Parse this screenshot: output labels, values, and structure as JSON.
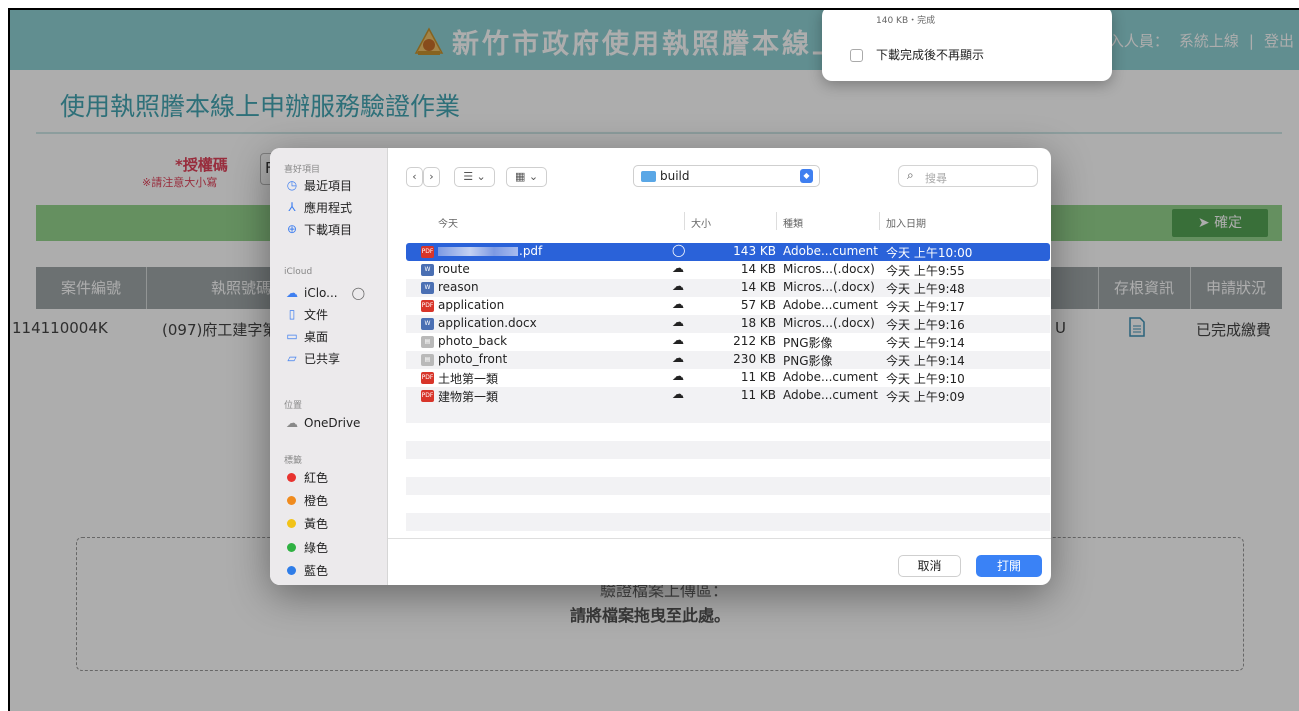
{
  "header": {
    "title": "新竹市政府使用執照謄本線上申",
    "user_label": "入人員：",
    "user_name": "系統上線",
    "separator": "|",
    "logout": "登出"
  },
  "page": {
    "title": "使用執照謄本線上申辦服務驗證作業",
    "auth_label": "*授權碼",
    "auth_note": "※請注意大小寫",
    "auth_value": "F",
    "confirm_button": "確定"
  },
  "table": {
    "headers": {
      "case_no": "案件編號",
      "license_no": "執照號碼",
      "stub_info": "存根資訊",
      "status": "申請狀況"
    },
    "row": {
      "case_no": "114110004K",
      "license_no": "(097)府工建字第",
      "extra": "U",
      "status": "已完成繳費"
    }
  },
  "drop_zone": {
    "line1": "驗證檔案上傳區：",
    "line2": "請將檔案拖曳至此處。"
  },
  "download_popover": {
    "status": "140 KB・完成",
    "checkbox_label": "下載完成後不再顯示"
  },
  "dialog": {
    "sidebar": {
      "favorites_title": "喜好項目",
      "favorites": [
        {
          "label": "最近項目",
          "icon": "clock-icon"
        },
        {
          "label": "應用程式",
          "icon": "apps-icon"
        },
        {
          "label": "下載項目",
          "icon": "download-icon"
        }
      ],
      "icloud_title": "iCloud",
      "icloud": [
        {
          "label": "iClo...",
          "icon": "cloud-icon"
        },
        {
          "label": "文件",
          "icon": "document-icon"
        },
        {
          "label": "桌面",
          "icon": "desktop-icon"
        },
        {
          "label": "已共享",
          "icon": "shared-folder-icon"
        }
      ],
      "locations_title": "位置",
      "locations": [
        {
          "label": "OneDrive",
          "icon": "cloud-icon"
        }
      ],
      "tags_title": "標籤",
      "tags": [
        {
          "label": "紅色",
          "color": "#e8332f"
        },
        {
          "label": "橙色",
          "color": "#f08b1e"
        },
        {
          "label": "黃色",
          "color": "#f2c318"
        },
        {
          "label": "綠色",
          "color": "#2fb142"
        },
        {
          "label": "藍色",
          "color": "#2f7de8"
        }
      ]
    },
    "toolbar": {
      "folder": "build",
      "search_placeholder": "搜尋"
    },
    "columns": {
      "name": "今天",
      "size": "大小",
      "kind": "種類",
      "date": "加入日期"
    },
    "files": [
      {
        "name": ".pdf",
        "icon": "pdf",
        "size": "143 KB",
        "kind": "Adobe...cument",
        "date": "今天 上午10:00",
        "selected": true
      },
      {
        "name": "route",
        "icon": "word",
        "size": "14 KB",
        "kind": "Micros...(.docx)",
        "date": "今天 上午9:55"
      },
      {
        "name": "reason",
        "icon": "word",
        "size": "14 KB",
        "kind": "Micros...(.docx)",
        "date": "今天 上午9:48"
      },
      {
        "name": "application",
        "icon": "pdf",
        "size": "57 KB",
        "kind": "Adobe...cument",
        "date": "今天 上午9:17"
      },
      {
        "name": "application.docx",
        "icon": "word",
        "size": "18 KB",
        "kind": "Micros...(.docx)",
        "date": "今天 上午9:16"
      },
      {
        "name": "photo_back",
        "icon": "png",
        "size": "212 KB",
        "kind": "PNG影像",
        "date": "今天 上午9:14"
      },
      {
        "name": "photo_front",
        "icon": "png",
        "size": "230 KB",
        "kind": "PNG影像",
        "date": "今天 上午9:14"
      },
      {
        "name": "土地第一類",
        "icon": "pdf",
        "size": "11 KB",
        "kind": "Adobe...cument",
        "date": "今天 上午9:10"
      },
      {
        "name": "建物第一類",
        "icon": "pdf",
        "size": "11 KB",
        "kind": "Adobe...cument",
        "date": "今天 上午9:09"
      }
    ],
    "cancel_button": "取消",
    "open_button": "打開"
  }
}
